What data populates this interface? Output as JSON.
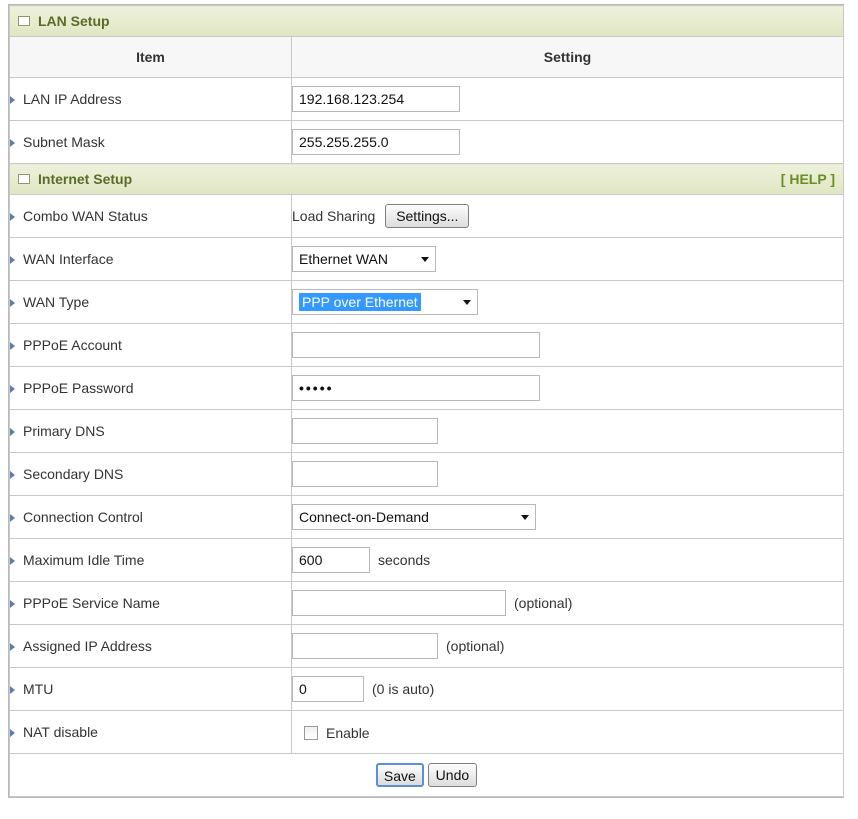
{
  "lan": {
    "section_title": "LAN Setup",
    "col_item": "Item",
    "col_setting": "Setting",
    "rows": [
      {
        "label": "LAN IP Address",
        "value": "192.168.123.254"
      },
      {
        "label": "Subnet Mask",
        "value": "255.255.255.0"
      }
    ]
  },
  "internet": {
    "section_title": "Internet Setup",
    "help": "[ HELP ]",
    "combo_label": "Combo WAN Status",
    "combo_value": "Load Sharing",
    "combo_button": "Settings...",
    "wan_interface_label": "WAN Interface",
    "wan_interface_value": "Ethernet WAN",
    "wan_type_label": "WAN Type",
    "wan_type_value": "PPP over Ethernet",
    "pppoe_account_label": "PPPoE Account",
    "pppoe_account_value": "",
    "pppoe_password_label": "PPPoE Password",
    "pppoe_password_value": "•••••",
    "primary_dns_label": "Primary DNS",
    "primary_dns_value": "",
    "secondary_dns_label": "Secondary DNS",
    "secondary_dns_value": "",
    "connection_control_label": "Connection Control",
    "connection_control_value": "Connect-on-Demand",
    "max_idle_label": "Maximum Idle Time",
    "max_idle_value": "600",
    "max_idle_suffix": "seconds",
    "service_name_label": "PPPoE Service Name",
    "service_name_value": "",
    "service_name_suffix": "(optional)",
    "assigned_ip_label": "Assigned IP Address",
    "assigned_ip_value": "",
    "assigned_ip_suffix": "(optional)",
    "mtu_label": "MTU",
    "mtu_value": "0",
    "mtu_suffix": "(0 is auto)",
    "nat_label": "NAT disable",
    "nat_checkbox_label": "Enable",
    "nat_checked": false
  },
  "footer": {
    "save": "Save",
    "undo": "Undo"
  }
}
